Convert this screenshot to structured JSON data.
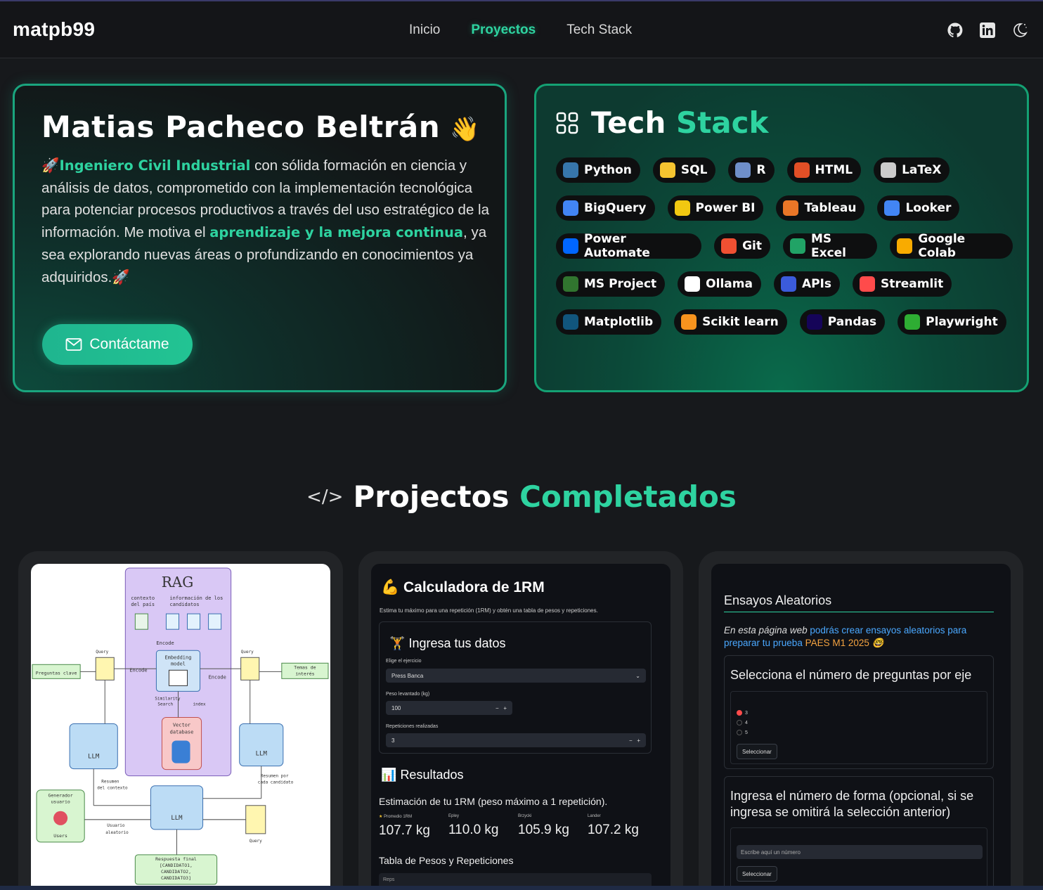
{
  "header": {
    "brand": "matpb99",
    "nav": [
      {
        "label": "Inicio",
        "active": false
      },
      {
        "label": "Proyectos",
        "active": true
      },
      {
        "label": "Tech Stack",
        "active": false
      }
    ],
    "icons": [
      "github-icon",
      "linkedin-icon",
      "theme-toggle-icon"
    ]
  },
  "hero": {
    "title": "Matias Pacheco Beltrán",
    "wave": "👋",
    "rocket": "🚀",
    "bold1": "Ingeniero Civil Industrial",
    "text1": " con sólida formación en ciencia y análisis de datos, comprometido con la implementación tecnológica para potenciar procesos productivos a través del uso estratégico de la información. Me motiva el ",
    "bold2": "aprendizaje y la mejora continua",
    "text2": ", ya sea explorando nuevas áreas o profundizando en conocimientos ya adquiridos.",
    "contact_label": "Contáctame"
  },
  "stack": {
    "title_a": "Tech",
    "title_b": "Stack",
    "chips": [
      [
        "Python",
        "SQL",
        "R",
        "HTML",
        "LaTeX"
      ],
      [
        "BigQuery",
        "Power BI",
        "Tableau",
        "Looker"
      ],
      [
        "Power Automate",
        "Git",
        "MS Excel",
        "Google Colab"
      ],
      [
        "MS Project",
        "Ollama",
        "APIs",
        "Streamlit"
      ],
      [
        "Matplotlib",
        "Scikit learn",
        "Pandas",
        "Playwright"
      ]
    ],
    "chip_colors": {
      "Python": "#3776ab",
      "SQL": "#f4c430",
      "R": "#6f8fc9",
      "HTML": "#e34f26",
      "LaTeX": "#cccccc",
      "BigQuery": "#4285f4",
      "Power BI": "#f2c811",
      "Tableau": "#e97627",
      "Looker": "#4285f4",
      "Power Automate": "#0066ff",
      "Git": "#f05032",
      "MS Excel": "#21a366",
      "Google Colab": "#f9ab00",
      "MS Project": "#31752f",
      "Ollama": "#ffffff",
      "APIs": "#3b5bdb",
      "Streamlit": "#ff4b4b",
      "Matplotlib": "#11557c",
      "Scikit learn": "#f7931e",
      "Pandas": "#150458",
      "Playwright": "#2ead33"
    }
  },
  "projects": {
    "heading_a": "Projectos",
    "heading_b": "Completados",
    "code_icon": "</>"
  },
  "rag": {
    "title": "RAG",
    "labels": {
      "ctx_pais": "contexto del país",
      "info_cand": "información de los candidatos",
      "encode": "Encode",
      "embedding": "Embedding model",
      "query": "Query",
      "preguntas": "Preguntas clave",
      "temas": "Temas de interés",
      "similarity": "Similarity Search",
      "index": "index",
      "vector": "Vector database",
      "llm": "LLM",
      "resumen_ctx": "Resumen del contexto",
      "resumen_cand": "Resumen por cada candidato",
      "docs_sim": "Documentos similares",
      "generador": "Generador usuario",
      "users": "Users",
      "usuario_aleatorio": "Usuario aleatorio",
      "respuesta": "Respuesta final [CANDIDATO1, CANDIDATO2, CANDIDATO3]"
    }
  },
  "calc": {
    "title": "Calculadora de 1RM",
    "emoji": "💪",
    "subtitle": "Estima tu máximo para una repetición (1RM) y obtén una tabla de pesos y repeticiones.",
    "panel_title": "Ingresa tus datos",
    "ejercicio_label": "Elige el ejercicio",
    "ejercicio_value": "Press Banca",
    "peso_label": "Peso levantado (kg)",
    "peso_value": "100",
    "reps_label": "Repeticiones realizadas",
    "reps_value": "3",
    "results_title": "Resultados",
    "estimation": "Estimación de tu 1RM (peso máximo a 1 repetición).",
    "metrics": [
      {
        "label": "Promedio 1RM",
        "value": "107.7 kg"
      },
      {
        "label": "Epley",
        "value": "110.0 kg"
      },
      {
        "label": "Brzycki",
        "value": "105.9 kg"
      },
      {
        "label": "Lander",
        "value": "107.2 kg"
      }
    ],
    "table_title": "Tabla de Pesos y Repeticiones",
    "table_col": "Reps"
  },
  "ensayos": {
    "title": "Ensayos Aleatorios",
    "desc_a": "En esta página web ",
    "desc_b": "podrás crear ensayos aleatorios para preparar tu prueba ",
    "desc_c": "PAES M1 2025",
    "desc_emoji": "🤓",
    "q1": "Selecciona el número de preguntas por eje",
    "options": [
      "3",
      "4",
      "5"
    ],
    "selected": "3",
    "btn": "Seleccionar",
    "q2": "Ingresa el número de forma (opcional, si se ingresa se omitirá la selección anterior)",
    "placeholder": "Escribe aquí un número",
    "btn2": "Seleccionar"
  }
}
